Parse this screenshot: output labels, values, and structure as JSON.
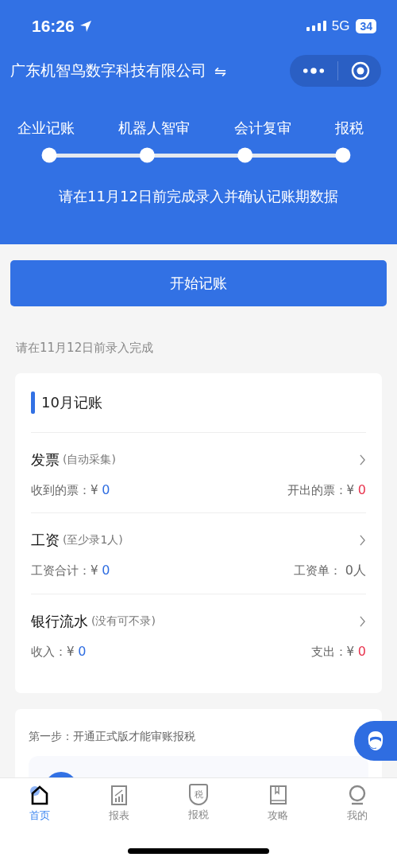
{
  "status_bar": {
    "time": "16:26",
    "network": "5G",
    "battery": "34"
  },
  "header": {
    "company": "广东机智鸟数字科技有限公司",
    "switch_glyph": "⇋",
    "steps": [
      "企业记账",
      "机器人智审",
      "会计复审",
      "报税"
    ],
    "notice": "请在11月12日前完成录入并确认记账期数据"
  },
  "start_button": "开始记账",
  "deadline_hint": "请在11月12日前录入完成",
  "bookkeeping_card": {
    "title": "10月记账",
    "sections": [
      {
        "name": "发票",
        "note": "(自动采集)",
        "stats": [
          {
            "label": "收到的票：¥",
            "value": "0",
            "color": "#2f6de1"
          },
          {
            "label": "开出的票：¥",
            "value": "0",
            "color": "#e8344e"
          }
        ]
      },
      {
        "name": "工资",
        "note": "(至少录1人)",
        "stats": [
          {
            "label": "工资合计：¥",
            "value": "0",
            "color": "#2f6de1"
          },
          {
            "label": "工资单：",
            "value": "0人",
            "color": "#666666"
          }
        ]
      },
      {
        "name": "银行流水",
        "note": "(没有可不录)",
        "stats": [
          {
            "label": "收入：¥",
            "value": "0",
            "color": "#2f6de1"
          },
          {
            "label": "支出：¥",
            "value": "0",
            "color": "#e8344e"
          }
        ]
      }
    ]
  },
  "upgrade_card": {
    "step_text": "第一步：开通正式版才能审账报税"
  },
  "tab_bar": [
    {
      "label": "首页",
      "kind": "home",
      "selected": true
    },
    {
      "label": "报表",
      "kind": "report",
      "selected": false
    },
    {
      "label": "报税",
      "kind": "tax",
      "selected": false,
      "icon_glyph": "税"
    },
    {
      "label": "攻略",
      "kind": "guide",
      "selected": false
    },
    {
      "label": "我的",
      "kind": "me",
      "selected": false
    }
  ]
}
